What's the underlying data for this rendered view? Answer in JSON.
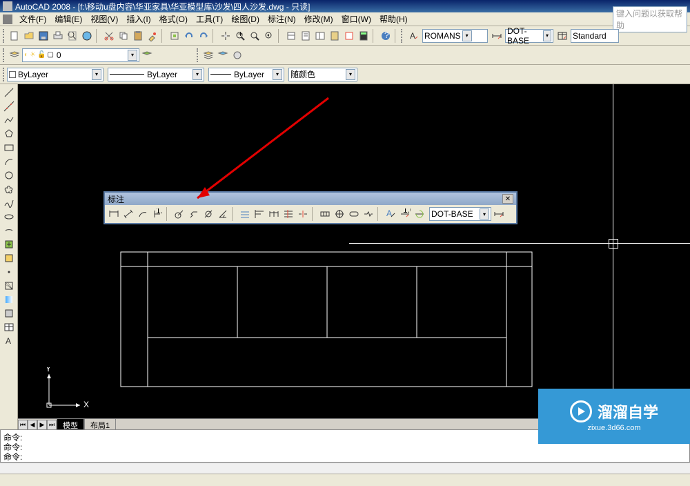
{
  "title_bar": {
    "text": "AutoCAD 2008 - [f:\\移动u盘内容\\华亚家具\\华亚模型库\\沙发\\四人沙发.dwg - 只读]"
  },
  "menu": {
    "file": "文件(F)",
    "edit": "编辑(E)",
    "view": "视图(V)",
    "insert": "插入(I)",
    "format": "格式(O)",
    "tools": "工具(T)",
    "draw": "绘图(D)",
    "dimension": "标注(N)",
    "modify": "修改(M)",
    "window": "窗口(W)",
    "help": "帮助(H)",
    "help_placeholder": "键入问题以获取帮助"
  },
  "toolbar_std": {
    "font_style": "ROMANS",
    "dim_style": "DOT-BASE",
    "table_style": "Standard"
  },
  "layer_bar": {
    "layer": "0",
    "bylayer1": "ByLayer",
    "bylayer2": "ByLayer",
    "bylayer3": "ByLayer",
    "color": "随颜色"
  },
  "float_toolbar": {
    "title": "标注",
    "dim_style": "DOT-BASE"
  },
  "ucs": {
    "x": "X",
    "y": "Y"
  },
  "tabs": {
    "model": "模型",
    "layout1": "布局1"
  },
  "command": {
    "line1": "命令:",
    "line2": "命令:",
    "line3": "命令:"
  },
  "watermark": {
    "main": "溜溜自学",
    "sub": "zixue.3d66.com"
  }
}
